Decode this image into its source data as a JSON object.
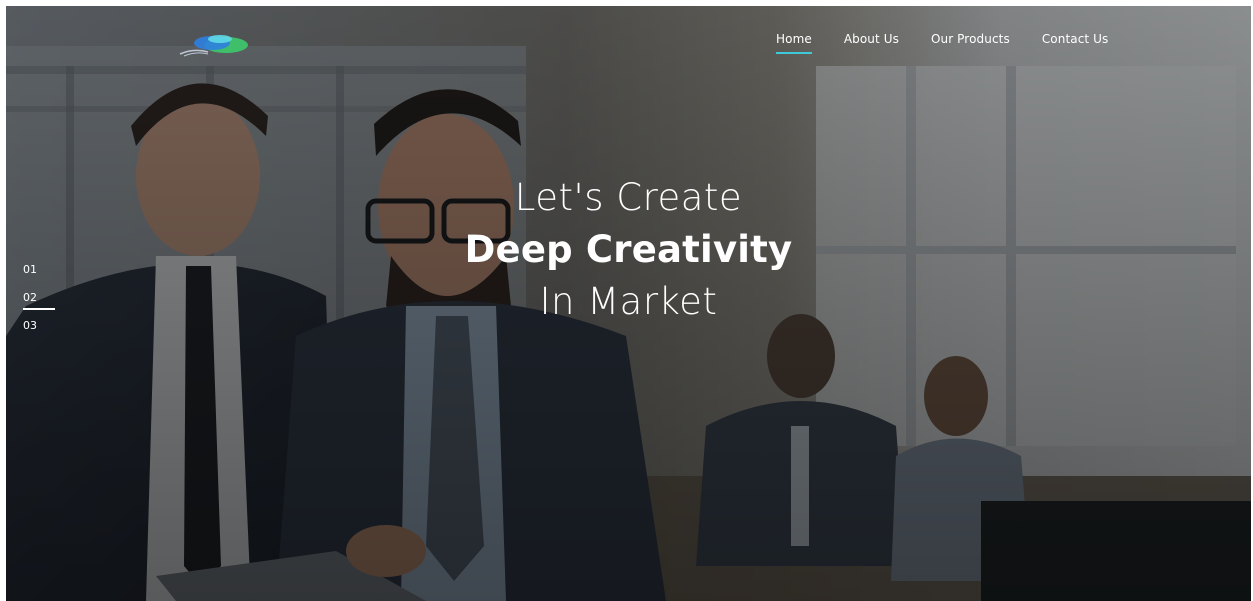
{
  "nav": {
    "items": [
      {
        "label": "Home",
        "active": true
      },
      {
        "label": "About Us",
        "active": false
      },
      {
        "label": "Our Products",
        "active": false
      },
      {
        "label": "Contact Us",
        "active": false
      }
    ]
  },
  "hero": {
    "line1": "Let's Create",
    "line2": "Deep Creativity",
    "line3": "In Market"
  },
  "slider": {
    "items": [
      "01",
      "02",
      "03"
    ],
    "active_index": 1
  },
  "colors": {
    "accent": "#3ec8d8",
    "text": "#ffffff",
    "overlay": "#1e2126"
  }
}
